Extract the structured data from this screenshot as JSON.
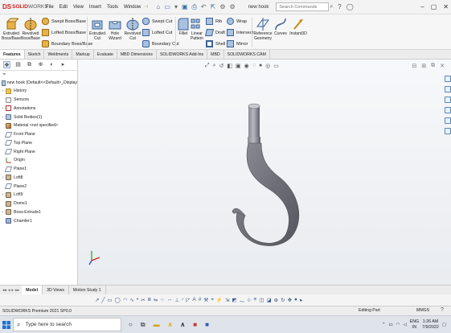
{
  "app": {
    "logo_ds": "DS",
    "logo_name": "SOLID",
    "logo_name2": "WORKS",
    "menu": [
      "File",
      "Edit",
      "View",
      "Insert",
      "Tools",
      "Window"
    ],
    "pin": "⊣",
    "document_name": "new hook",
    "search_placeholder": "Search Commands"
  },
  "commands": {
    "extruded_boss": [
      "Extruded",
      "Boss/Base"
    ],
    "revolved_boss": [
      "Revolved",
      "Boss/Base"
    ],
    "swept_boss": "Swept Boss/Base",
    "lofted_boss": "Lofted Boss/Base",
    "boundary_boss": "Boundary Boss/Base",
    "extruded_cut": [
      "Extruded",
      "Cut"
    ],
    "hole_wizard": [
      "Hole",
      "Wizard"
    ],
    "revolved_cut": [
      "Revolved",
      "Cut"
    ],
    "swept_cut": "Swept Cut",
    "lofted_cut": "Lofted Cut",
    "boundary_cut": "Boundary Cut",
    "fillet": "Fillet",
    "linear_pattern": [
      "Linear",
      "Pattern"
    ],
    "rib": "Rib",
    "draft": "Draft",
    "shell": "Shell",
    "wrap": "Wrap",
    "intersect": "Intersect",
    "mirror": "Mirror",
    "reference_geometry": [
      "Reference",
      "Geometry"
    ],
    "curves": "Curves",
    "instant3d": "Instant3D"
  },
  "tabs": [
    "Features",
    "Sketch",
    "Weldments",
    "Markup",
    "Evaluate",
    "MBD Dimensions",
    "SOLIDWORKS Add-Ins",
    "MBD",
    "SOLIDWORKS CAM"
  ],
  "feature_tree": {
    "root": "new hook  (Default<<Default>_Display",
    "items": [
      {
        "label": "History",
        "icon": "folder-icon",
        "arrow": "›"
      },
      {
        "label": "Sensors",
        "icon": "sensor-icon",
        "arrow": ""
      },
      {
        "label": "Annotations",
        "icon": "annotation-icon",
        "arrow": "›"
      },
      {
        "label": "Solid Bodies(1)",
        "icon": "solid-body-icon",
        "arrow": "›"
      },
      {
        "label": "Material <not specified>",
        "icon": "material-icon",
        "arrow": ""
      },
      {
        "label": "Front Plane",
        "icon": "plane-icon",
        "arrow": ""
      },
      {
        "label": "Top Plane",
        "icon": "plane-icon",
        "arrow": ""
      },
      {
        "label": "Right Plane",
        "icon": "plane-icon",
        "arrow": ""
      },
      {
        "label": "Origin",
        "icon": "origin-icon",
        "arrow": ""
      },
      {
        "label": "Plane1",
        "icon": "plane-icon",
        "arrow": ""
      },
      {
        "label": "Loft8",
        "icon": "feature-icon",
        "arrow": "›"
      },
      {
        "label": "Plane2",
        "icon": "plane-icon",
        "arrow": ""
      },
      {
        "label": "Loft9",
        "icon": "feature-icon",
        "arrow": "›"
      },
      {
        "label": "Dome1",
        "icon": "feature-icon",
        "arrow": ""
      },
      {
        "label": "Boss-Extrude1",
        "icon": "feature-icon",
        "arrow": "›"
      },
      {
        "label": "Chamfer1",
        "icon": "chamfer-icon",
        "arrow": ""
      }
    ]
  },
  "bottom_tabs": [
    "Model",
    "3D Views",
    "Motion Study 1"
  ],
  "status": {
    "left": "SOLIDWORKS Premium 2021 SP0.0",
    "edit": "Editing Part",
    "units": "MMGS",
    "help": "?"
  },
  "taskbar": {
    "search": "Type here to search",
    "weather": "",
    "lang1": "ENG",
    "lang2": "IN",
    "time": "1:26 AM",
    "date": "7/9/2022"
  },
  "colors": {
    "accent": "#d81e1e",
    "toolbar_bg": "#f6f6f6",
    "graphics_bg": "#eef0f3",
    "hook_body": "#6f7077"
  }
}
